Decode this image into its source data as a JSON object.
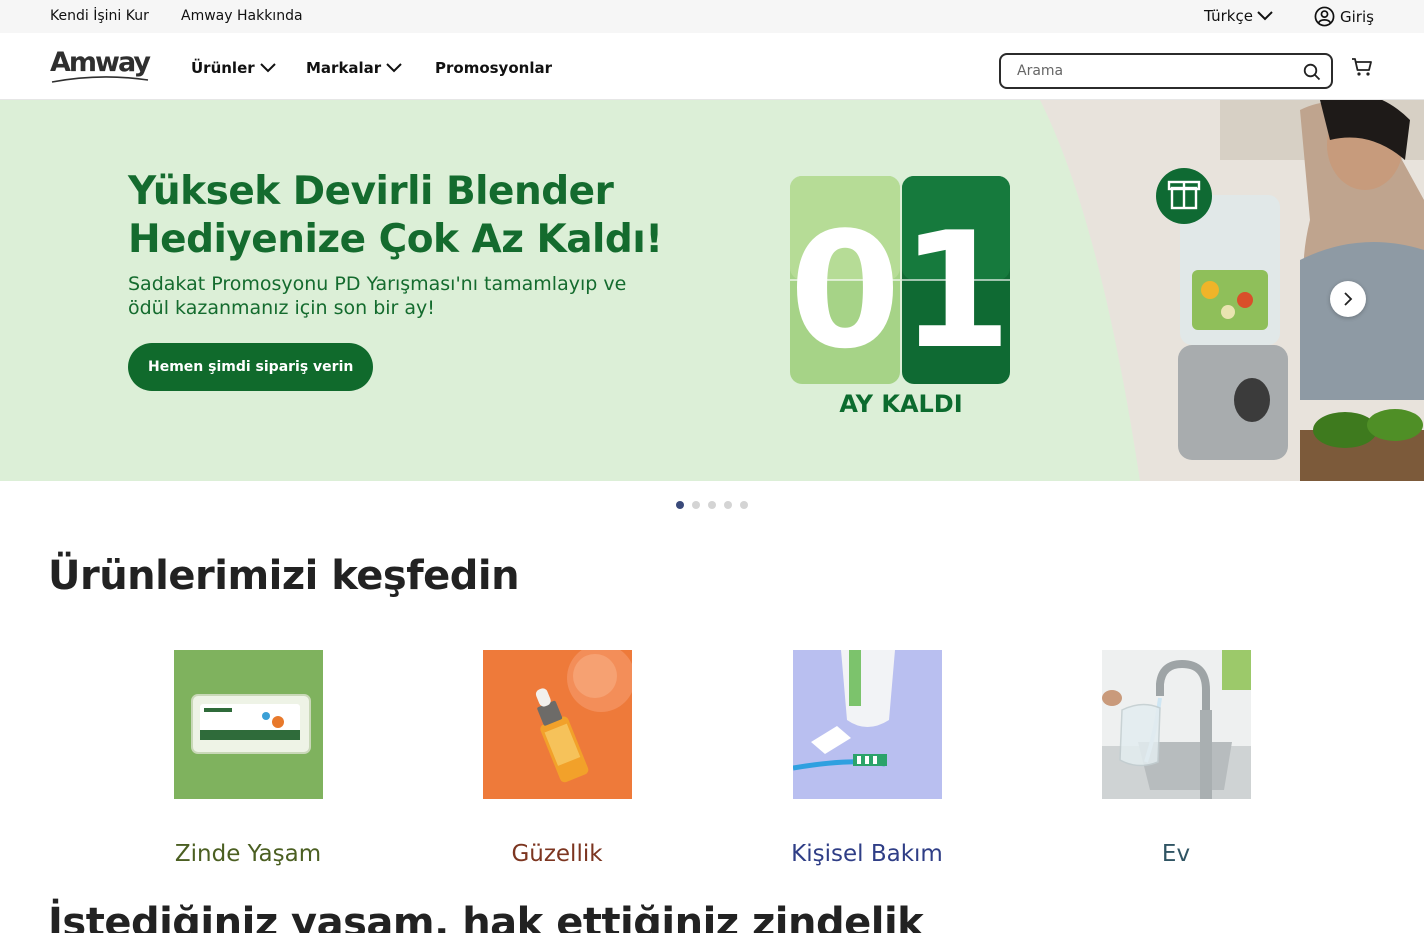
{
  "utility": {
    "kendi_isini_kur": "Kendi İşini Kur",
    "amway_hakkinda": "Amway Hakkında",
    "language": "Türkçe",
    "login": "Giriş"
  },
  "header": {
    "logo": "Amway",
    "nav": {
      "urunler": "Ürünler",
      "markalar": "Markalar",
      "promosyonlar": "Promosyonlar"
    },
    "search_placeholder": "Arama"
  },
  "hero": {
    "title_line1": "Yüksek Devirli Blender",
    "title_line2": "Hediyenize Çok Az Kaldı!",
    "subtitle": "Sadakat Promosyonu PD Yarışması'nı tamamlayıp ve ödül kazanmanız için son bir ay!",
    "cta": "Hemen şimdi sipariş verin",
    "count_digit_1": "0",
    "count_digit_2": "1",
    "count_caption": "AY KALDI"
  },
  "carousel": {
    "slide_count": 5,
    "active_index": 0
  },
  "discover": {
    "title": "Ürünlerimizi keşfedin",
    "categories": [
      {
        "label": "Zinde Yaşam",
        "color": "#4b5f22"
      },
      {
        "label": "Güzellik",
        "color": "#7c3520"
      },
      {
        "label": "Kişisel Bakım",
        "color": "#2f3e86"
      },
      {
        "label": "Ev",
        "color": "#2f5463"
      }
    ]
  },
  "next_section_title": "İstediğiniz yaşam, hak ettiğiniz zindelik",
  "colors": {
    "brand_green": "#146b2e",
    "hero_bg": "#dcefd7",
    "dot_active": "#3a4a7a"
  }
}
